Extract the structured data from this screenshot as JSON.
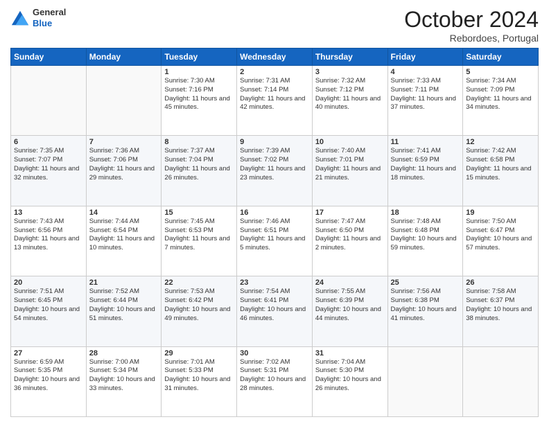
{
  "header": {
    "logo_general": "General",
    "logo_blue": "Blue",
    "month_title": "October 2024",
    "location": "Rebordoes, Portugal"
  },
  "days_of_week": [
    "Sunday",
    "Monday",
    "Tuesday",
    "Wednesday",
    "Thursday",
    "Friday",
    "Saturday"
  ],
  "weeks": [
    [
      {
        "day": "",
        "info": ""
      },
      {
        "day": "",
        "info": ""
      },
      {
        "day": "1",
        "info": "Sunrise: 7:30 AM\nSunset: 7:16 PM\nDaylight: 11 hours and 45 minutes."
      },
      {
        "day": "2",
        "info": "Sunrise: 7:31 AM\nSunset: 7:14 PM\nDaylight: 11 hours and 42 minutes."
      },
      {
        "day": "3",
        "info": "Sunrise: 7:32 AM\nSunset: 7:12 PM\nDaylight: 11 hours and 40 minutes."
      },
      {
        "day": "4",
        "info": "Sunrise: 7:33 AM\nSunset: 7:11 PM\nDaylight: 11 hours and 37 minutes."
      },
      {
        "day": "5",
        "info": "Sunrise: 7:34 AM\nSunset: 7:09 PM\nDaylight: 11 hours and 34 minutes."
      }
    ],
    [
      {
        "day": "6",
        "info": "Sunrise: 7:35 AM\nSunset: 7:07 PM\nDaylight: 11 hours and 32 minutes."
      },
      {
        "day": "7",
        "info": "Sunrise: 7:36 AM\nSunset: 7:06 PM\nDaylight: 11 hours and 29 minutes."
      },
      {
        "day": "8",
        "info": "Sunrise: 7:37 AM\nSunset: 7:04 PM\nDaylight: 11 hours and 26 minutes."
      },
      {
        "day": "9",
        "info": "Sunrise: 7:39 AM\nSunset: 7:02 PM\nDaylight: 11 hours and 23 minutes."
      },
      {
        "day": "10",
        "info": "Sunrise: 7:40 AM\nSunset: 7:01 PM\nDaylight: 11 hours and 21 minutes."
      },
      {
        "day": "11",
        "info": "Sunrise: 7:41 AM\nSunset: 6:59 PM\nDaylight: 11 hours and 18 minutes."
      },
      {
        "day": "12",
        "info": "Sunrise: 7:42 AM\nSunset: 6:58 PM\nDaylight: 11 hours and 15 minutes."
      }
    ],
    [
      {
        "day": "13",
        "info": "Sunrise: 7:43 AM\nSunset: 6:56 PM\nDaylight: 11 hours and 13 minutes."
      },
      {
        "day": "14",
        "info": "Sunrise: 7:44 AM\nSunset: 6:54 PM\nDaylight: 11 hours and 10 minutes."
      },
      {
        "day": "15",
        "info": "Sunrise: 7:45 AM\nSunset: 6:53 PM\nDaylight: 11 hours and 7 minutes."
      },
      {
        "day": "16",
        "info": "Sunrise: 7:46 AM\nSunset: 6:51 PM\nDaylight: 11 hours and 5 minutes."
      },
      {
        "day": "17",
        "info": "Sunrise: 7:47 AM\nSunset: 6:50 PM\nDaylight: 11 hours and 2 minutes."
      },
      {
        "day": "18",
        "info": "Sunrise: 7:48 AM\nSunset: 6:48 PM\nDaylight: 10 hours and 59 minutes."
      },
      {
        "day": "19",
        "info": "Sunrise: 7:50 AM\nSunset: 6:47 PM\nDaylight: 10 hours and 57 minutes."
      }
    ],
    [
      {
        "day": "20",
        "info": "Sunrise: 7:51 AM\nSunset: 6:45 PM\nDaylight: 10 hours and 54 minutes."
      },
      {
        "day": "21",
        "info": "Sunrise: 7:52 AM\nSunset: 6:44 PM\nDaylight: 10 hours and 51 minutes."
      },
      {
        "day": "22",
        "info": "Sunrise: 7:53 AM\nSunset: 6:42 PM\nDaylight: 10 hours and 49 minutes."
      },
      {
        "day": "23",
        "info": "Sunrise: 7:54 AM\nSunset: 6:41 PM\nDaylight: 10 hours and 46 minutes."
      },
      {
        "day": "24",
        "info": "Sunrise: 7:55 AM\nSunset: 6:39 PM\nDaylight: 10 hours and 44 minutes."
      },
      {
        "day": "25",
        "info": "Sunrise: 7:56 AM\nSunset: 6:38 PM\nDaylight: 10 hours and 41 minutes."
      },
      {
        "day": "26",
        "info": "Sunrise: 7:58 AM\nSunset: 6:37 PM\nDaylight: 10 hours and 38 minutes."
      }
    ],
    [
      {
        "day": "27",
        "info": "Sunrise: 6:59 AM\nSunset: 5:35 PM\nDaylight: 10 hours and 36 minutes."
      },
      {
        "day": "28",
        "info": "Sunrise: 7:00 AM\nSunset: 5:34 PM\nDaylight: 10 hours and 33 minutes."
      },
      {
        "day": "29",
        "info": "Sunrise: 7:01 AM\nSunset: 5:33 PM\nDaylight: 10 hours and 31 minutes."
      },
      {
        "day": "30",
        "info": "Sunrise: 7:02 AM\nSunset: 5:31 PM\nDaylight: 10 hours and 28 minutes."
      },
      {
        "day": "31",
        "info": "Sunrise: 7:04 AM\nSunset: 5:30 PM\nDaylight: 10 hours and 26 minutes."
      },
      {
        "day": "",
        "info": ""
      },
      {
        "day": "",
        "info": ""
      }
    ]
  ]
}
